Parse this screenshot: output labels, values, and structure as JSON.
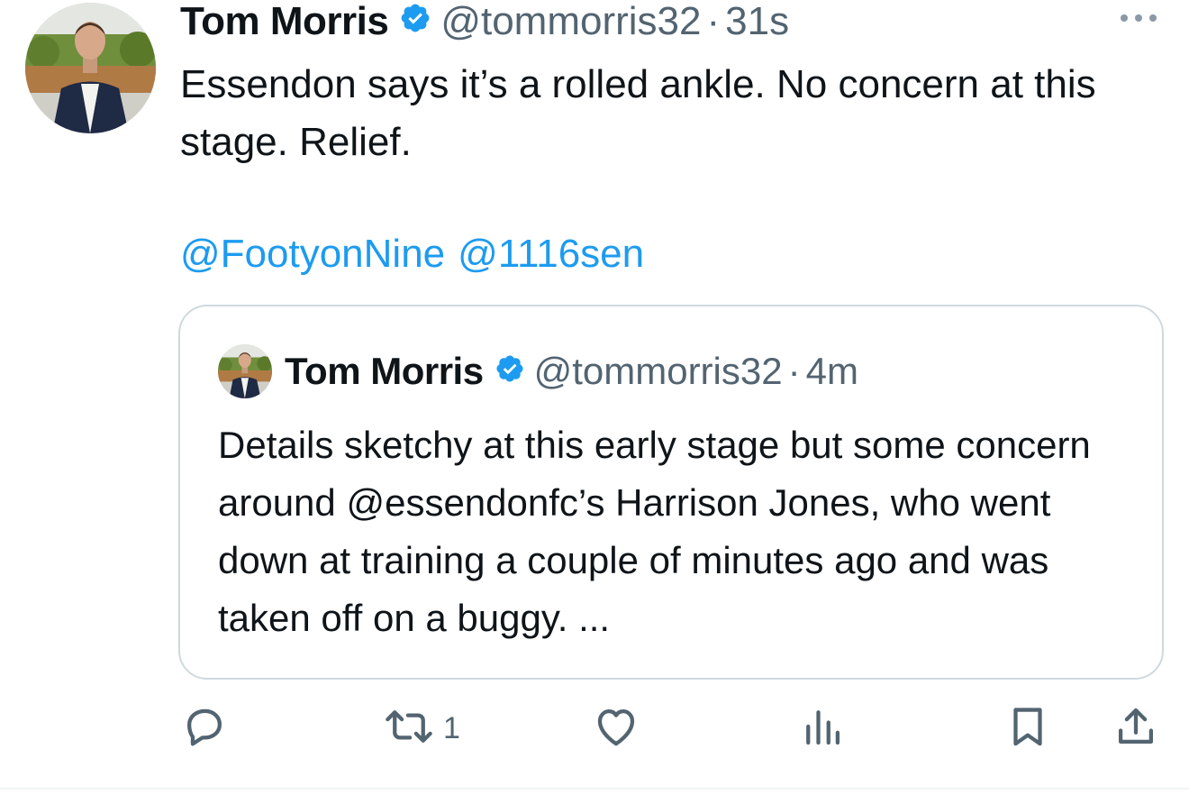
{
  "tweet": {
    "author_name": "Tom Morris",
    "handle": "@tommorris32",
    "separator": "·",
    "time": "31s",
    "text": "Essendon says it’s a rolled ankle. No concern at this stage. Relief.",
    "mentions": [
      "@FootyonNine",
      "@1116sen"
    ],
    "more_icon": "more-horizontal-icon",
    "verified_icon": "verified-badge-icon"
  },
  "quoted_tweet": {
    "author_name": "Tom Morris",
    "handle": "@tommorris32",
    "separator": "·",
    "time": "4m",
    "text": "Details sketchy at this early stage but some concern around @essendonfc’s Harrison Jones, who went down at training a couple of minutes ago and was taken off on a buggy. ..."
  },
  "actions": {
    "reply_icon": "reply-icon",
    "retweet_icon": "retweet-icon",
    "retweet_count": "1",
    "like_icon": "heart-icon",
    "views_icon": "views-chart-icon",
    "bookmark_icon": "bookmark-icon",
    "share_icon": "share-icon"
  },
  "colors": {
    "text": "#0f1419",
    "secondary": "#536471",
    "link": "#1d9bf0",
    "verified": "#1d9bf0",
    "border": "#cfd9de"
  }
}
